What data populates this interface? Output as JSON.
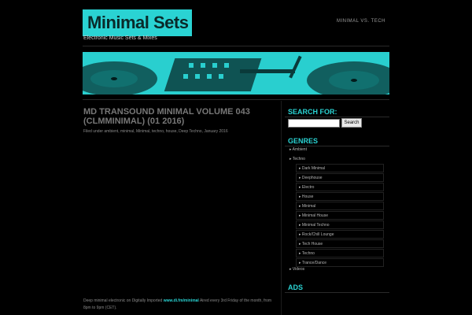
{
  "site": {
    "title": "Minimal Sets",
    "tagline": "Electronic Music Sets & Mixes"
  },
  "nav": {
    "items": [
      "MINIMAL VS. TECH"
    ]
  },
  "post": {
    "title": "MD TRANSOUND MINIMAL VOLUME 043 (CLMMINIMAL) (01 2016)",
    "meta": "Filed under ambient, minimal, Minimal, techno, house, Deep Techno, January 2016",
    "body_prefix": "Deep minimal electronic on Digitally Imported",
    "body_link": "www.di.fm/minimal",
    "body_suffix": "Aired every 3rd Friday of the month, from 8pm to 9pm (CET)."
  },
  "sidebar": {
    "search_heading": "SEARCH FOR:",
    "search_button": "Search",
    "search_value": "",
    "genres_heading": "GENRES",
    "genres": [
      "Ambient",
      "Techno"
    ],
    "techno_sub": [
      "Dark Minimal",
      "Deephouse",
      "Electro",
      "House",
      "Minimal",
      "Minimal House",
      "Minimal Techno",
      "Rock/Chill Lounge",
      "Tech House",
      "Techno",
      "Trance/Dance"
    ],
    "genres_after": [
      "Videos"
    ],
    "ads_heading": "ADS"
  },
  "colors": {
    "accent": "#2ad3d3",
    "background": "#000000"
  }
}
